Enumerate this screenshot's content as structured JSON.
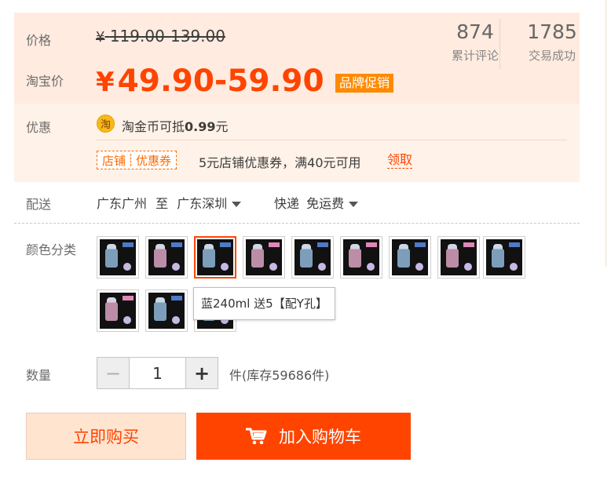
{
  "price": {
    "label": "价格",
    "currency": "¥",
    "original": "119.00-139.00"
  },
  "taobao_price": {
    "label": "淘宝价",
    "currency": "¥",
    "value": "49.90-59.90",
    "tag": "品牌促销"
  },
  "stats": {
    "reviews_count": "874",
    "reviews_label": "累计评论",
    "sold_count": "1785",
    "sold_label": "交易成功"
  },
  "promotions": {
    "label": "优惠",
    "coin_icon_glyph": "淘",
    "coin_text_prefix": "淘金币可抵",
    "coin_amount": "0.99",
    "coin_text_suffix": "元",
    "coupon_badge_left": "店铺",
    "coupon_badge_right": "优惠券",
    "coupon_text": "5元店铺优惠券，满40元可用",
    "claim_link": "领取"
  },
  "shipping": {
    "label": "配送",
    "from": "广东广州",
    "to_word": "至",
    "to": "广东深圳",
    "method": "快递",
    "fee": "免运费"
  },
  "variants": {
    "label": "颜色分类",
    "selected_index": 2,
    "tooltip": "蓝240ml 送5【配Y孔】"
  },
  "quantity": {
    "label": "数量",
    "value": "1",
    "minus": "−",
    "plus": "+",
    "stock_text": "件(库存59686件)"
  },
  "actions": {
    "buy_now": "立即购买",
    "add_to_cart": "加入购物车"
  },
  "colors": {
    "accent": "#ff4400",
    "price_bg": "#ffebdf",
    "promo_bg": "#fff2e8",
    "brand_tag": "#ff8a00"
  },
  "icons": {
    "coin": "taobao-coin-icon",
    "caret": "caret-down-icon",
    "cart": "shopping-cart-icon"
  }
}
